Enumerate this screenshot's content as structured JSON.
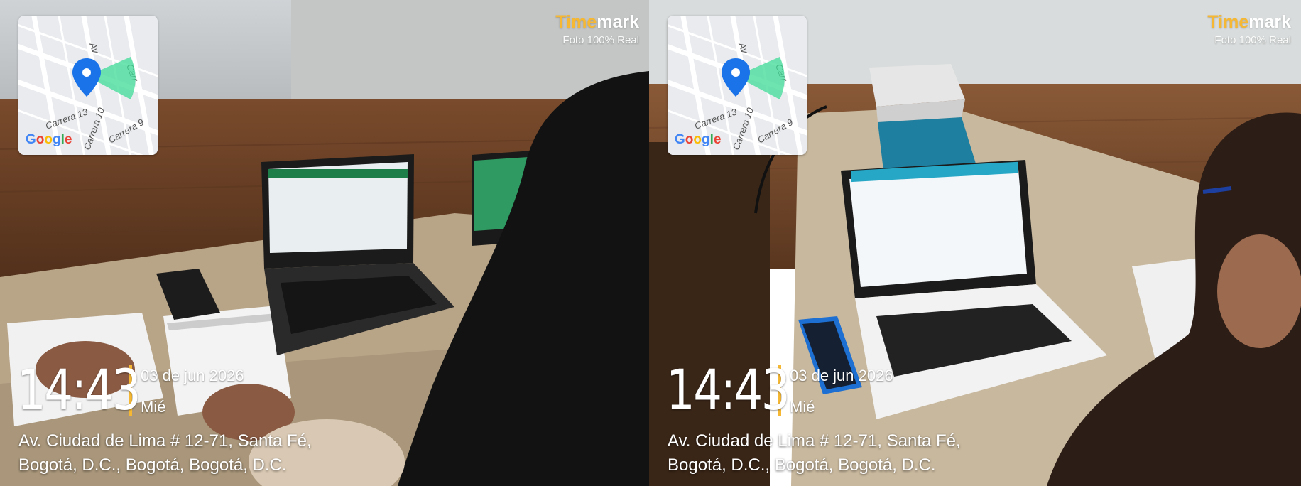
{
  "photos": [
    {
      "brand": {
        "part1": "Time",
        "part2": "mark",
        "tagline": "Foto 100% Real"
      },
      "map": {
        "logo": "Google",
        "pin_icon": "location-pin-icon",
        "streets": [
          "Av",
          "Carrera 13",
          "Carrera 10",
          "Carrera 9",
          "Carrera 2"
        ]
      },
      "stamp": {
        "time": "14:43",
        "date": "03 de jun 2026",
        "day": "Mié"
      },
      "address": {
        "line1": "Av. Ciudad de Lima # 12-71, Santa Fé,",
        "line2": "Bogotá, D.C., Bogotá, Bogotá, D.C."
      }
    },
    {
      "brand": {
        "part1": "Time",
        "part2": "mark",
        "tagline": "Foto 100% Real"
      },
      "map": {
        "logo": "Google",
        "pin_icon": "location-pin-icon",
        "streets": [
          "Av",
          "Carrera 13",
          "Carrera 10",
          "Carrera 9",
          "Carrera 2"
        ]
      },
      "stamp": {
        "time": "14:43",
        "date": "03 de jun 2026",
        "day": "Mié"
      },
      "address": {
        "line1": "Av. Ciudad de Lima # 12-71, Santa Fé,",
        "line2": "Bogotá, D.C., Bogotá, Bogotá, D.C."
      }
    }
  ],
  "colors": {
    "accent": "#f6b833",
    "pin": "#1a73e8",
    "heading_cone": "#3ddc97"
  }
}
